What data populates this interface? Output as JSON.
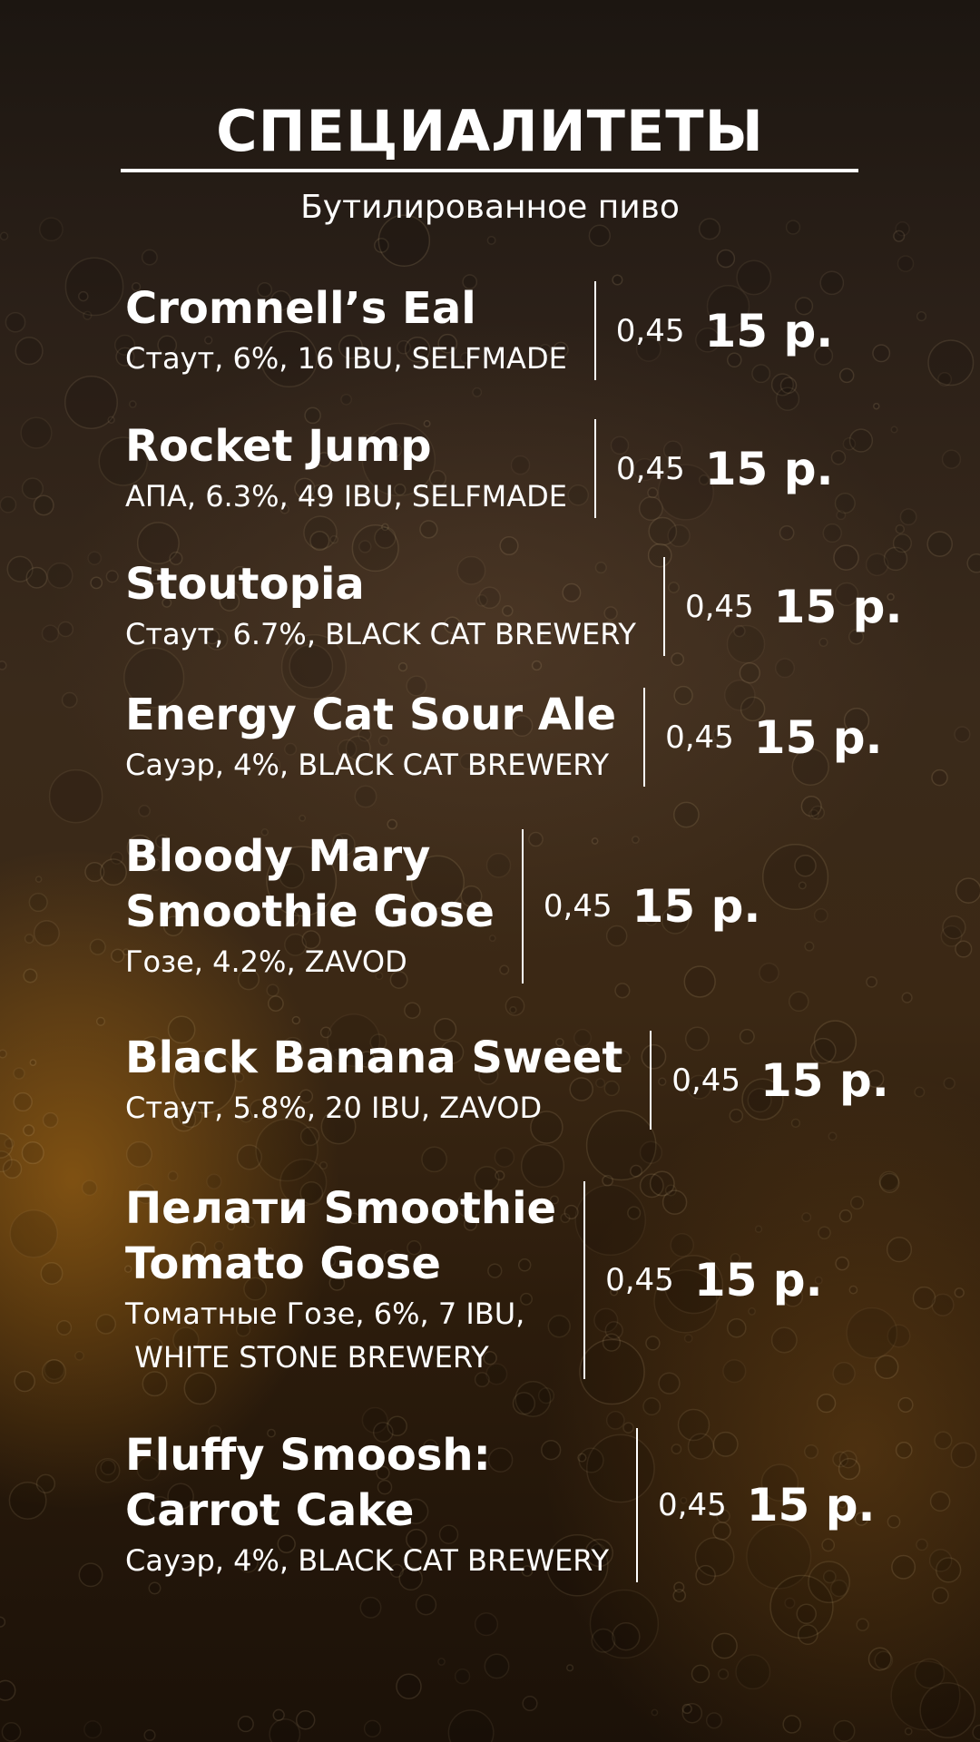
{
  "menu": {
    "title": "СПЕЦИАЛИТЕТЫ",
    "subtitle": "Бутилированное пиво",
    "items": [
      {
        "name_lines": [
          "Cromnell’s Eal"
        ],
        "desc_lines": [
          "Стаут, 6%, 16 IBU, SELFMADE"
        ],
        "volume": "0,45",
        "price": "15 р."
      },
      {
        "name_lines": [
          "Rocket Jump"
        ],
        "desc_lines": [
          "АПА, 6.3%, 49 IBU, SELFMADE"
        ],
        "volume": "0,45",
        "price": "15 р."
      },
      {
        "name_lines": [
          "Stoutopia"
        ],
        "desc_lines": [
          "Стаут, 6.7%, BLACK CAT BREWERY"
        ],
        "volume": "0,45",
        "price": "15 р."
      },
      {
        "name_lines": [
          "Energy Cat Sour Ale"
        ],
        "desc_lines": [
          "Сауэр, 4%, BLACK CAT BREWERY"
        ],
        "volume": "0,45",
        "price": "15 р."
      },
      {
        "name_lines": [
          "Bloody Mary",
          "Smoothie Gose"
        ],
        "desc_lines": [
          "Гозе, 4.2%, ZAVOD"
        ],
        "volume": "0,45",
        "price": "15 р."
      },
      {
        "name_lines": [
          "Black Banana Sweet"
        ],
        "desc_lines": [
          "Стаут, 5.8%, 20 IBU, ZAVOD"
        ],
        "volume": "0,45",
        "price": "15 р."
      },
      {
        "name_lines": [
          "Пелати Smoothie",
          "Tomato Gose"
        ],
        "desc_lines": [
          "Томатные Гозе, 6%, 7 IBU,",
          " WHITE STONE BREWERY"
        ],
        "volume": "0,45",
        "price": "15 р."
      },
      {
        "name_lines": [
          "Fluffy Smoosh:",
          "Carrot Cake"
        ],
        "desc_lines": [
          "Сауэр, 4%, BLACK CAT BREWERY"
        ],
        "volume": "0,45",
        "price": "15 р."
      }
    ]
  }
}
